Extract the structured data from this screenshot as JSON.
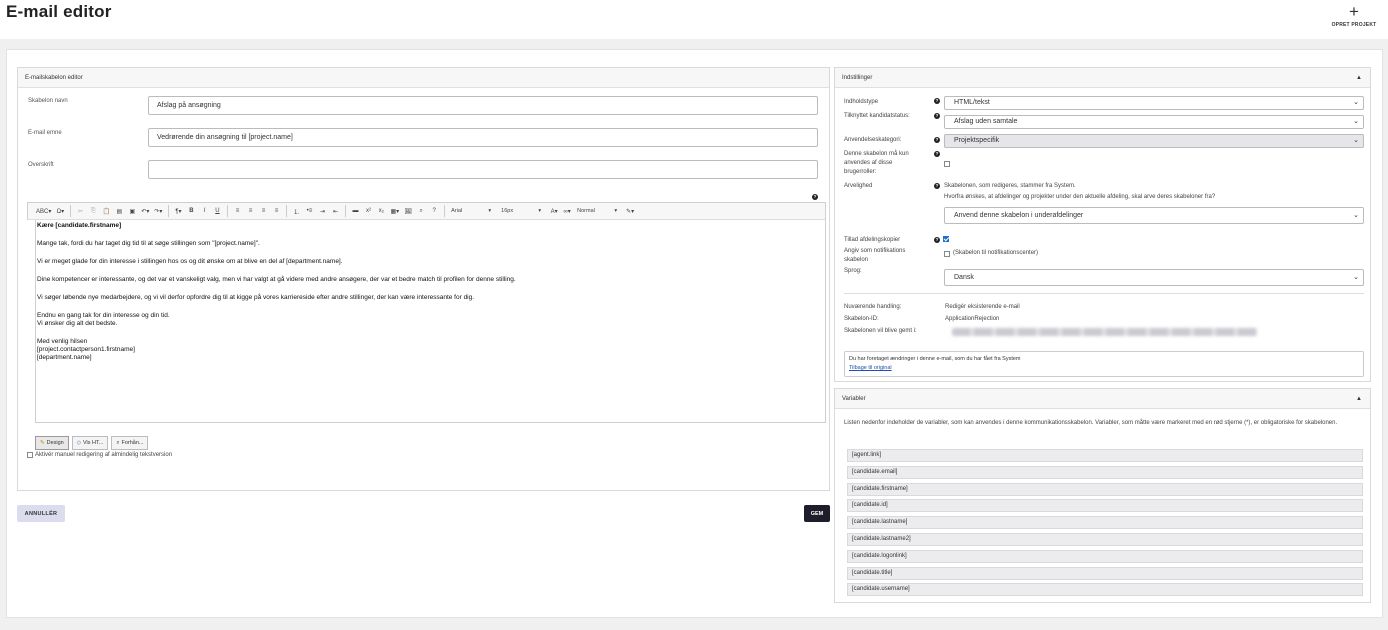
{
  "header": {
    "title": "E-mail editor",
    "create_project_label": "OPRET PROJEKT"
  },
  "editor_panel": {
    "title": "E-mailskabelon editor",
    "fields": [
      {
        "label": "Skabelon navn",
        "value": "Afslag på ansøgning"
      },
      {
        "label": "E-mail emne",
        "value": "Vedrørende din ansøgning til [project.name]"
      },
      {
        "label": "Overskrift",
        "value": ""
      }
    ],
    "toolbar": {
      "font": "Arial",
      "size": "16px",
      "paragraph_style": "Normal"
    },
    "body": {
      "greeting": "Kære [candidate.firstname]",
      "paragraphs": [
        "Mange tak, fordi du har taget dig tid til at søge stillingen som \"[project.name]\".",
        "Vi er meget glade for din interesse i stillingen hos os og dit ønske om at blive en del af [department.name].",
        "Dine kompetencer er interessante, og det var et vanskeligt valg, men vi har valgt at gå videre med andre ansøgere, der var et bedre match til profilen for denne stilling.",
        "Vi søger løbende nye medarbejdere, og vi vil derfor opfordre dig til at kigge på vores karriereside efter andre stillinger, der kan være interessante for dig."
      ],
      "closing_lines": [
        "Endnu en gang tak for din interesse og din tid.",
        "Vi ønsker dig alt det bedste."
      ],
      "signature_lines": [
        "Med venlig hilsen",
        "[project.contactperson1.firstname]",
        "[department.name]"
      ]
    },
    "mode_tabs": [
      "Design",
      "Vis HT...",
      "Forhån..."
    ],
    "manual_edit_label": "Aktivér manuel redigering af almindelig tekstversion"
  },
  "actions": {
    "cancel_label": "ANNULLÉR",
    "save_label": "GEM"
  },
  "settings": {
    "title": "Indstillinger",
    "content_type_label": "Indholdstype",
    "content_type_value": "HTML/tekst",
    "status_label": "Tilknyttet kandidatstatus:",
    "status_value": "Afslag uden samtale",
    "category_label": "Anvendelseskategori:",
    "category_value": "Projektspecifik",
    "roles_label_lines": [
      "Denne skabelon må kun",
      "anvendes af disse",
      "brugerroller:"
    ],
    "inheritance_label": "Arvelighed",
    "inheritance_text1": "Skabelonen, som redigeres, stammer fra System.",
    "inheritance_text2": "Hvorfra ønskes, at afdelinger og projekter under den aktuelle afdeling, skal arve deres skabeloner fra?",
    "inheritance_value": "Anvend denne skabelon i underafdelinger",
    "allow_copies_label": "Tillad afdelingskopier",
    "notification_label_lines": [
      "Angiv som notifikations",
      "skabelon"
    ],
    "notification_option": "(Skabelon til notifikationscenter)",
    "language_label": "Sprog:",
    "language_value": "Dansk",
    "current_action_label": "Nuværende handling:",
    "current_action_value": "Redigér eksisterende e-mail",
    "template_id_label": "Skabelon-ID:",
    "template_id_value": "ApplicationRejection",
    "saved_as_label": "Skabelonen vil blive gemt i:",
    "notice_text": "Du har foretaget ændringer i denne e-mail, som du har fået fra System",
    "notice_link": "Tilbage til original"
  },
  "variables": {
    "title": "Variabler",
    "description": "Listen nedenfor indeholder de variabler, som kan anvendes i denne kommunikationsskabelon. Variabler, som måtte være markeret med en rød stjerne (*), er obligatoriske for skabelonen.",
    "items": [
      "[agent.link]",
      "[candidate.email]",
      "[candidate.firstname]",
      "[candidate.id]",
      "[candidate.lastname]",
      "[candidate.lastname2]",
      "[candidate.logonlink]",
      "[candidate.title]",
      "[candidate.username]"
    ]
  }
}
